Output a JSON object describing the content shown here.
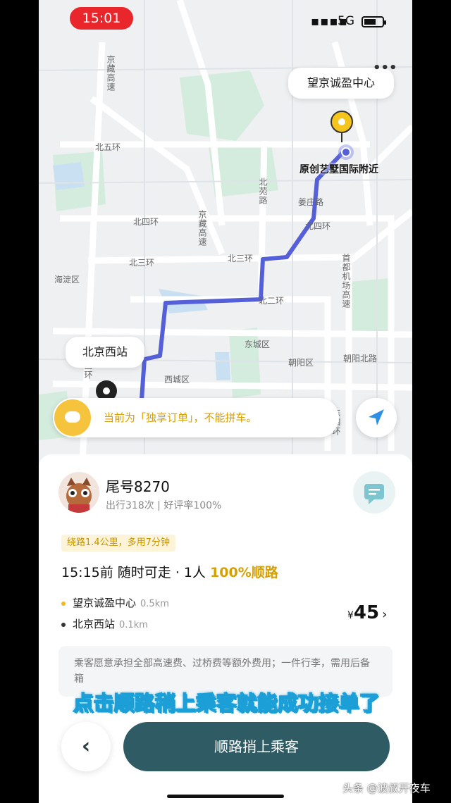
{
  "status_bar": {
    "time": "15:01",
    "signal": "▪▪▪▪",
    "network": "5G"
  },
  "map": {
    "destination_label": "望京诚盈中心",
    "current_location_label": "原创艺墅国际附近",
    "origin_label": "北京西站",
    "district_labels": [
      "北五环",
      "北四环",
      "北三环",
      "北二环",
      "北三环",
      "北四环",
      "东城区",
      "西城区",
      "朝阳区",
      "海淀区",
      "朝阳北路",
      "姜庄路",
      "京藏高速",
      "京藏高速",
      "北苑路",
      "西三环",
      "东四环",
      "首都机场高速"
    ],
    "route_color": "#5560d8"
  },
  "notice": {
    "text": "当前为「独享订单」，不能拼车。"
  },
  "order": {
    "plate": "尾号8270",
    "stats": "出行318次 | 好评率100%",
    "detour_tag": "绕路1.4公里，多用7分钟",
    "headline": "15:15前  随时可走 · 1人",
    "match": "100%顺路",
    "stops": [
      {
        "name": "望京诚盈中心",
        "distance": "0.5km",
        "color": "#f3b71c"
      },
      {
        "name": "北京西站",
        "distance": "0.1km",
        "color": "#333333"
      }
    ],
    "currency": "¥",
    "price": "45",
    "price_chevron": "›",
    "note": "乘客愿意承担全部高速费、过桥费等额外费用；一件行李，需用后备箱"
  },
  "overlay_caption": "点击顺路稍上乘客就能成功接单了",
  "actions": {
    "back": "‹",
    "accept": "顺路捎上乘客"
  },
  "watermark": "头条 @波叔开夜车",
  "colors": {
    "accent": "#d6a000",
    "primary_button": "#2f5c64",
    "status_pill": "#e8262c"
  }
}
